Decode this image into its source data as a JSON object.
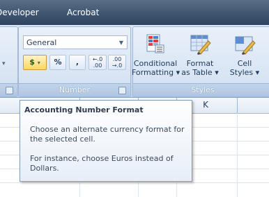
{
  "tabs": [
    "Developer",
    "Acrobat"
  ],
  "number_group": {
    "format_combo_value": "General",
    "currency_symbol": "$",
    "percent_symbol": "%",
    "comma_symbol": ",",
    "increase_decimal": "←.0 .00",
    "decrease_decimal": ".00 →.0",
    "label": "Number"
  },
  "styles_group": {
    "conditional_formatting": [
      "Conditional",
      "Formatting ▾"
    ],
    "format_as_table": [
      "Format",
      "as Table ▾"
    ],
    "cell_styles": [
      "Cell",
      "Styles ▾"
    ],
    "label": "Styles"
  },
  "grid": {
    "column_header_visible": "K"
  },
  "tooltip": {
    "title": "Accounting Number Format",
    "paragraph1": "Choose an alternate currency format for the selected cell.",
    "paragraph2": "For instance, choose Euros instead of Dollars."
  },
  "colors": {
    "tabbar": "#3f5570",
    "ribbon": "#c9d9ee",
    "active_button": "#ffd55e"
  }
}
